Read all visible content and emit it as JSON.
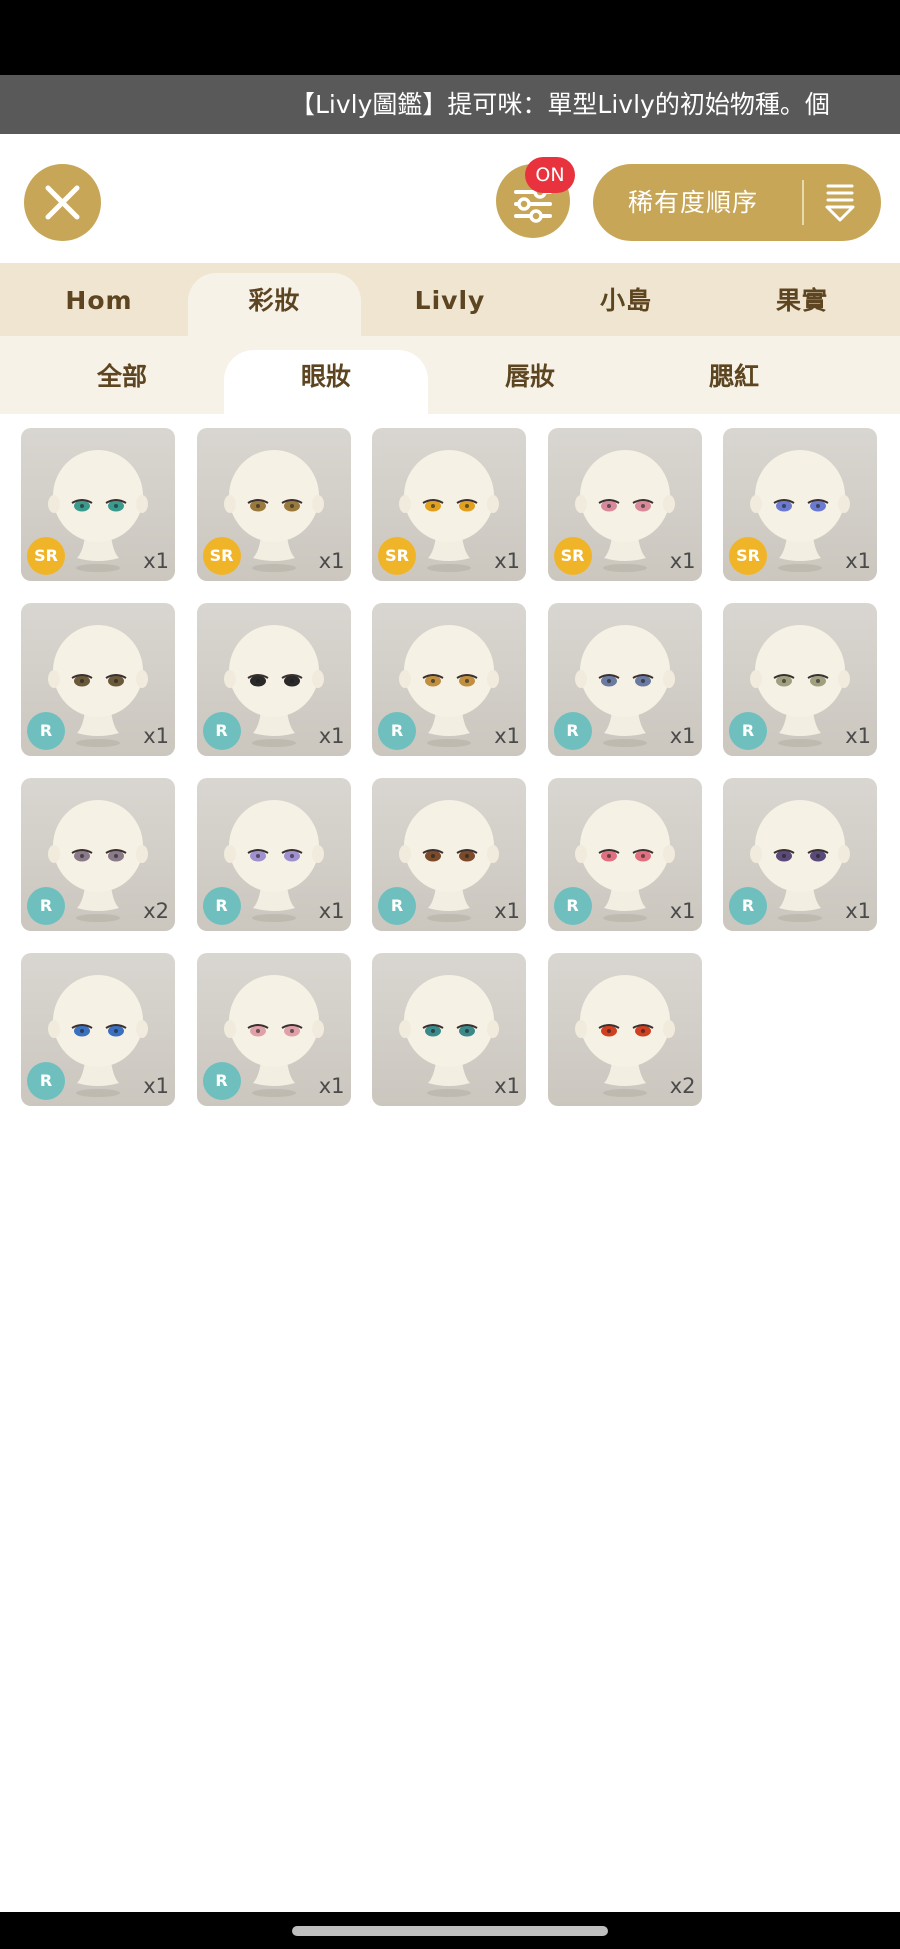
{
  "ticker": {
    "text": "【Livly圖鑑】提可咪：單型Livly的初始物種。個"
  },
  "toolbar": {
    "filter_badge": "ON",
    "sort_label": "稀有度順序"
  },
  "main_tabs": [
    {
      "label": "Hom",
      "active": false
    },
    {
      "label": "彩妝",
      "active": true
    },
    {
      "label": "Livly",
      "active": false
    },
    {
      "label": "小島",
      "active": false
    },
    {
      "label": "果實",
      "active": false
    }
  ],
  "sub_tabs": [
    {
      "label": "全部",
      "active": false
    },
    {
      "label": "眼妝",
      "active": true
    },
    {
      "label": "唇妝",
      "active": false
    },
    {
      "label": "腮紅",
      "active": false
    }
  ],
  "items": [
    {
      "rarity": "SR",
      "count": "x1",
      "eye_color": "#3a9a8e"
    },
    {
      "rarity": "SR",
      "count": "x1",
      "eye_color": "#9a7a3c"
    },
    {
      "rarity": "SR",
      "count": "x1",
      "eye_color": "#e0a020"
    },
    {
      "rarity": "SR",
      "count": "x1",
      "eye_color": "#d98a9a"
    },
    {
      "rarity": "SR",
      "count": "x1",
      "eye_color": "#6a7ad0"
    },
    {
      "rarity": "R",
      "count": "x1",
      "eye_color": "#6a5a3a"
    },
    {
      "rarity": "R",
      "count": "x1",
      "eye_color": "#2a2a2a"
    },
    {
      "rarity": "R",
      "count": "x1",
      "eye_color": "#c09040"
    },
    {
      "rarity": "R",
      "count": "x1",
      "eye_color": "#6a7aa0"
    },
    {
      "rarity": "R",
      "count": "x1",
      "eye_color": "#a0a080"
    },
    {
      "rarity": "R",
      "count": "x2",
      "eye_color": "#8a7a8a"
    },
    {
      "rarity": "R",
      "count": "x1",
      "eye_color": "#a090d0"
    },
    {
      "rarity": "R",
      "count": "x1",
      "eye_color": "#7a4a2a"
    },
    {
      "rarity": "R",
      "count": "x1",
      "eye_color": "#e07080"
    },
    {
      "rarity": "R",
      "count": "x1",
      "eye_color": "#5a4a7a"
    },
    {
      "rarity": "R",
      "count": "x1",
      "eye_color": "#3a70c0"
    },
    {
      "rarity": "R",
      "count": "x1",
      "eye_color": "#e0a0a8"
    },
    {
      "rarity": "",
      "count": "x1",
      "eye_color": "#3a8a8a"
    },
    {
      "rarity": "",
      "count": "x2",
      "eye_color": "#d04020"
    }
  ]
}
